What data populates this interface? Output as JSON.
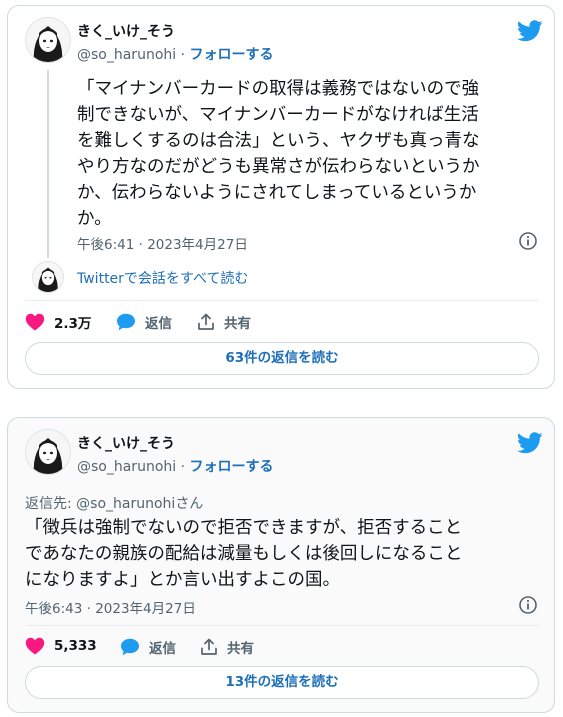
{
  "colors": {
    "brand_blue": "#1d9bf0",
    "link_blue": "#1d6fb8",
    "like_pink": "#f91880"
  },
  "tweet1": {
    "author_name": "きく_いけ_そう",
    "author_handle": "@so_harunohi",
    "separator": " · ",
    "follow_label": "フォローする",
    "text": "「マイナンバーカードの取得は義務ではないので強\n制できないが、マイナンバーカードがなければ生活\nを難しくするのは合法」という、ヤクザも真っ青な\nやり方なのだがどうも異常さが伝わらないというか\nか、伝わらないようにされてしまっているというか\nか。",
    "timestamp": "午後6:41 · 2023年4月27日",
    "conversation_link": "Twitterで会話をすべて読む",
    "likes": "2.3万",
    "reply_label": "返信",
    "share_label": "共有",
    "read_replies_label": "63件の返信を読む"
  },
  "tweet2": {
    "author_name": "きく_いけ_そう",
    "author_handle": "@so_harunohi",
    "separator": " · ",
    "follow_label": "フォローする",
    "reply_to_prefix": "返信先: ",
    "reply_to_handle": "@so_harunohi",
    "reply_to_suffix": "さん",
    "text": "「徴兵は強制でないので拒否できますが、拒否すること\nであなたの親族の配給は減量もしくは後回しになること\nになりますよ」とか言い出すよこの国。",
    "timestamp": "午後6:43 · 2023年4月27日",
    "likes": "5,333",
    "reply_label": "返信",
    "share_label": "共有",
    "read_replies_label": "13件の返信を読む"
  },
  "icons": {
    "logo": "twitter-bird-icon",
    "info": "info-icon",
    "like": "heart-icon",
    "reply": "speech-bubble-icon",
    "share": "share-upload-icon"
  }
}
